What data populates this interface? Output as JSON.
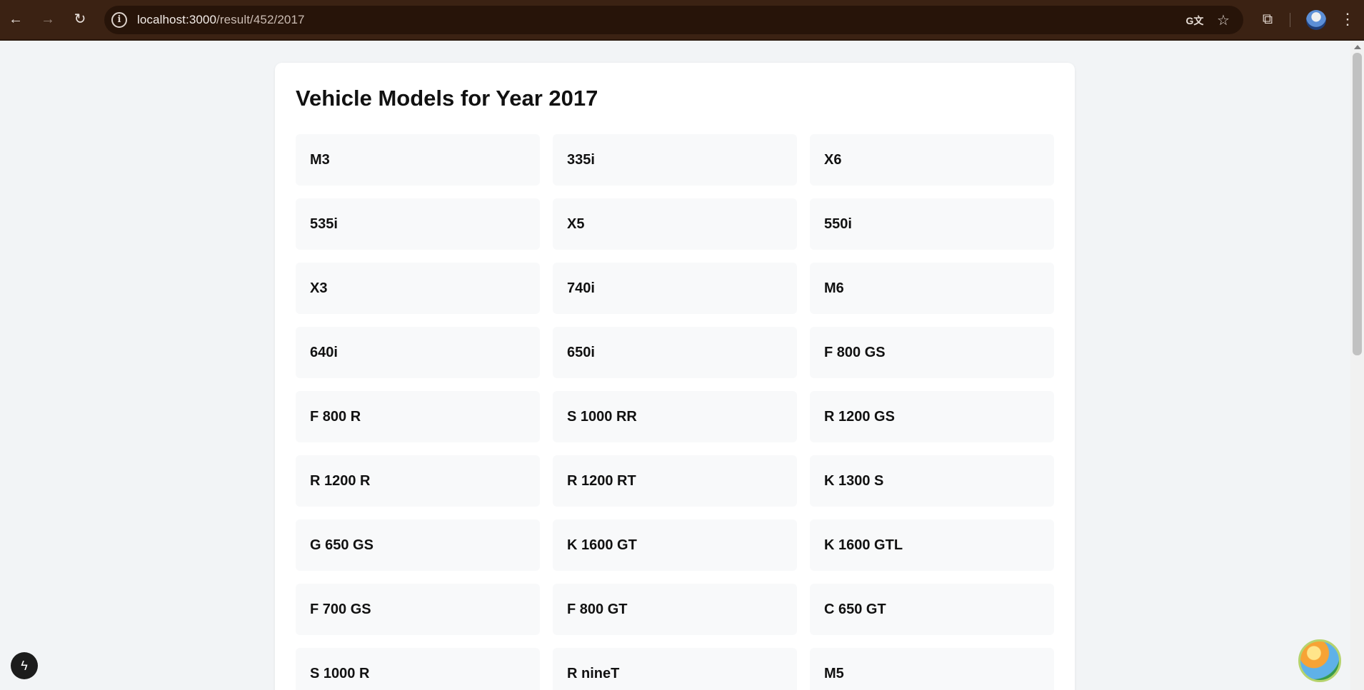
{
  "browser": {
    "url_host": "localhost:3000",
    "url_path": "/result/452/2017",
    "icons": {
      "back": "arrow-left-icon",
      "forward": "arrow-right-icon",
      "reload": "reload-icon",
      "site_info": "info-icon",
      "translate": "translate-icon",
      "bookmark": "star-icon",
      "extensions": "puzzle-icon",
      "profile": "avatar",
      "menu": "kebab-menu-icon"
    }
  },
  "page": {
    "title": "Vehicle Models for Year 2017",
    "models": [
      "M3",
      "335i",
      "X6",
      "535i",
      "X5",
      "550i",
      "X3",
      "740i",
      "M6",
      "640i",
      "650i",
      "F 800 GS",
      "F 800 R",
      "S 1000 RR",
      "R 1200 GS",
      "R 1200 R",
      "R 1200 RT",
      "K 1300 S",
      "G 650 GS",
      "K 1600 GT",
      "K 1600 GTL",
      "F 700 GS",
      "F 800 GT",
      "C 650 GT",
      "S 1000 R",
      "R nineT",
      "M5"
    ]
  },
  "colors": {
    "chrome": "#3b2213",
    "omnibox": "#271409",
    "page_background": "#f2f4f6",
    "card": "#ffffff",
    "model_tile": "#f8f9fa"
  }
}
